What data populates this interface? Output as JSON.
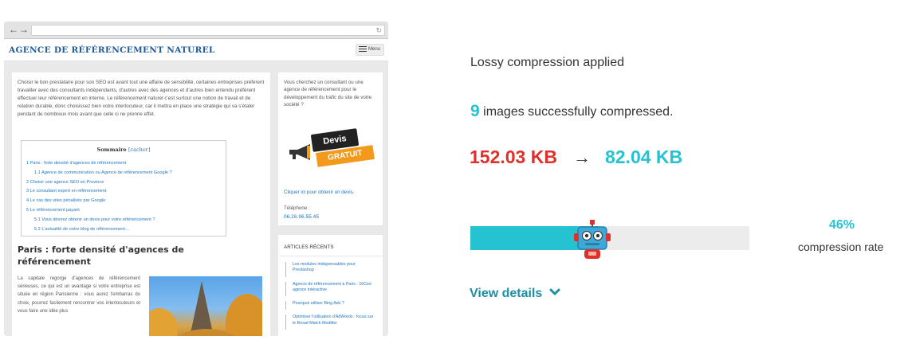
{
  "preview": {
    "site_title": "AGENCE DE RÉFÉRENCEMENT NATUREL",
    "menu_label": "Menu",
    "intro": "Choisir le bon prestataire pour son SEO est avant tout une affaire de sensibilité, certaines entreprises préfèrent travailler avec des consultants indépendants, d'autres avec des agences et d'autres bien entendu préfèrent effectuer leur référencement en interne. Le référencement naturel c'est surtout une notion de travail et de relation durable, donc choisissez bien votre interlocuteur, car il mettra en place une stratégie qui va s'étaler pendant de nombreux mois avant que celle ci ne prenne effet.",
    "toc": {
      "title": "Sommaire",
      "hide_label": "[cacher]",
      "items": [
        "1 Paris : forte densité d'agences de référencement",
        "1.1 Agence de communication ou Agence de référencement Google ?",
        "2 Choisir une agence SEO en Province",
        "3 Le consultant expert en référencement",
        "4 Le cas des sites pénalisés par Google",
        "5 Le référencement payant",
        "5.1 Vous désirez obtenir un devis pour votre référencement ?",
        "5.2 L'actualité de notre blog de référencement…"
      ]
    },
    "heading": "Paris : forte densité d'agences de référencement",
    "paragraph": "La capitale regorge d'agences de référencement sérieuses, ce qui est un avantage si votre entreprise est située en région Parisienne : vous aurez l'embarras du choix, pourrez facilement rencontrer vos interlocuteurs et vous faire une idée plus",
    "sidebar": {
      "question": "Vous cherchez un consultant ou une agence de référencement pour le développement du trafic du site de votre société ?",
      "devis": "Devis",
      "gratuit": "GRATUIT",
      "cta": "Cliquer ici pour obtenir un devis.",
      "phone_label": "Téléphone :",
      "phone": "06.26.96.55.45"
    },
    "recent": {
      "title": "ARTICLES RÉCENTS",
      "items": [
        "Les modules indispensables pour Prestashop",
        "Agence de référencement à Paris : 10Ceo agence intéractive",
        "Pourquoi utiliser Bing Ads ?",
        "Optimiser l'utilisation d'AdWords : focus sur le Broad Match Modifier"
      ]
    }
  },
  "result": {
    "mode": "Lossy compression applied",
    "images_count": "9",
    "images_text": "images successfully compressed.",
    "size_before": "152.03 KB",
    "arrow": "→",
    "size_after": "82.04 KB",
    "compression_percent": "46%",
    "compression_fraction": 0.46,
    "compression_label": "compression rate",
    "view_details": "View details"
  },
  "colors": {
    "accent": "#25c3d2",
    "before": "#e0302c",
    "link": "#1e8fa3"
  }
}
